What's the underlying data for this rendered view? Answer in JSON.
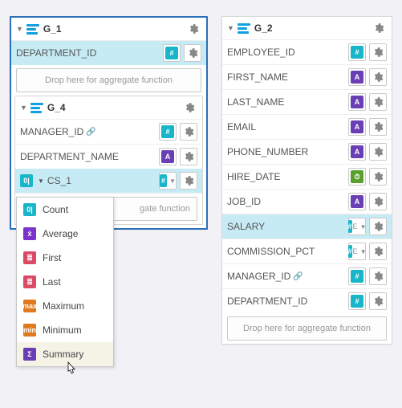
{
  "g1": {
    "title": "G_1",
    "drop_text": "Drop here for aggregate function",
    "fields": [
      {
        "name": "DEPARTMENT_ID",
        "type": "num",
        "hl": true
      }
    ],
    "g4": {
      "title": "G_4",
      "fields": [
        {
          "name": "MANAGER_ID",
          "type": "num",
          "key": true
        },
        {
          "name": "DEPARTMENT_NAME",
          "type": "str"
        }
      ],
      "cs": {
        "name": "CS_1",
        "drop_text": "gate function"
      }
    }
  },
  "g2": {
    "title": "G_2",
    "drop_text": "Drop here for aggregate function",
    "fields": [
      {
        "name": "EMPLOYEE_ID",
        "type": "num"
      },
      {
        "name": "FIRST_NAME",
        "type": "str"
      },
      {
        "name": "LAST_NAME",
        "type": "str"
      },
      {
        "name": "EMAIL",
        "type": "str"
      },
      {
        "name": "PHONE_NUMBER",
        "type": "str"
      },
      {
        "name": "HIRE_DATE",
        "type": "date"
      },
      {
        "name": "JOB_ID",
        "type": "str"
      },
      {
        "name": "SALARY",
        "type": "calc",
        "hl": true,
        "expand": true
      },
      {
        "name": "COMMISSION_PCT",
        "type": "calc",
        "expand": true
      },
      {
        "name": "MANAGER_ID",
        "type": "num",
        "key": true
      },
      {
        "name": "DEPARTMENT_ID",
        "type": "num"
      }
    ]
  },
  "menu": {
    "items": [
      {
        "label": "Count",
        "cls": "c-ct",
        "g": "0|"
      },
      {
        "label": "Average",
        "cls": "c-av",
        "g": "x̄"
      },
      {
        "label": "First",
        "cls": "c-fl",
        "g": "≣"
      },
      {
        "label": "Last",
        "cls": "c-fl",
        "g": "≣"
      },
      {
        "label": "Maximum",
        "cls": "c-mx",
        "g": "max"
      },
      {
        "label": "Minimum",
        "cls": "c-mn",
        "g": "min"
      },
      {
        "label": "Summary",
        "cls": "c-sm",
        "g": "Σ",
        "cur": true
      }
    ]
  }
}
